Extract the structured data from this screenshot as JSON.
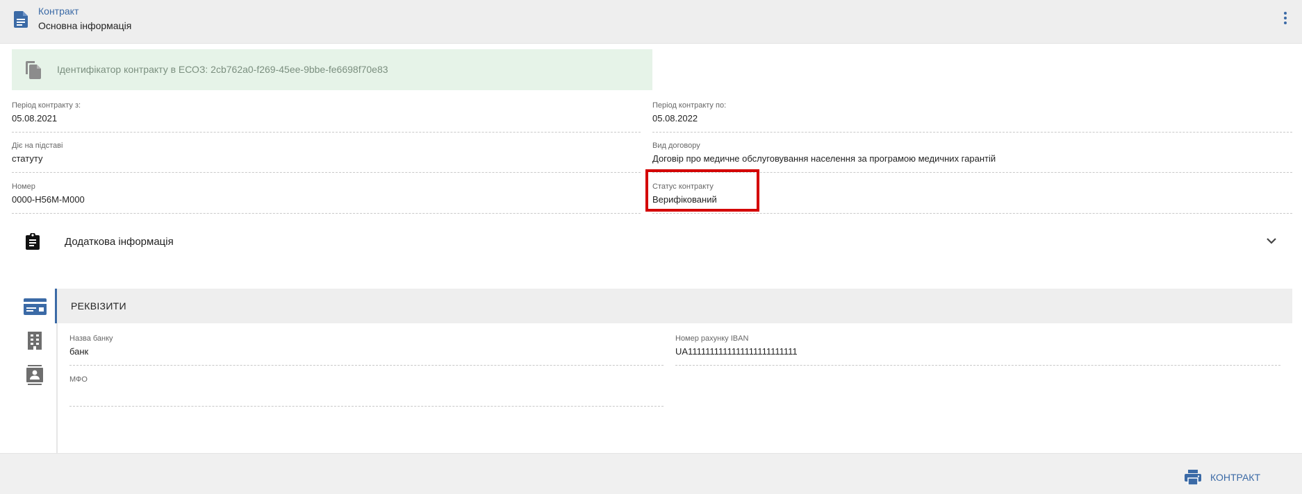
{
  "header": {
    "breadcrumb": "Контракт",
    "subtitle": "Основна інформація",
    "menu_icon": "more-vert-icon"
  },
  "id_banner": {
    "text": "Ідентифікатор контракту в ЕСОЗ: 2cb762a0-f269-45ee-9bbe-fe6698f70e83",
    "icon": "copy-icon"
  },
  "fields": {
    "period_from": {
      "label": "Період контракту з:",
      "value": "05.08.2021"
    },
    "period_to": {
      "label": "Період контракту по:",
      "value": "05.08.2022"
    },
    "basis": {
      "label": "Діє на підставі",
      "value": "статуту"
    },
    "contract_type": {
      "label": "Вид договору",
      "value": "Договір про медичне обслуговування населення за програмою медичних гарантій"
    },
    "number": {
      "label": "Номер",
      "value": "0000-H56M-M000"
    },
    "status": {
      "label": "Статус контракту",
      "value": "Верифікований"
    }
  },
  "additional": {
    "title": "Додаткова інформація",
    "icon": "clipboard-icon",
    "toggle_icon": "chevron-down-icon"
  },
  "requisites": {
    "title": "РЕКВІЗИТИ",
    "bank_name": {
      "label": "Назва банку",
      "value": "банк"
    },
    "iban": {
      "label": "Номер рахунку IBAN",
      "value": "UA1111111111111111111111111"
    },
    "mfo": {
      "label": "МФО",
      "value": ""
    }
  },
  "side_icons": [
    "credit-card-icon",
    "building-icon",
    "contact-card-icon"
  ],
  "footer": {
    "print_label": "КОНТРАКТ",
    "print_icon": "printer-icon"
  },
  "colors": {
    "accent": "#3b6aa6",
    "banner_bg": "#e6f3e8",
    "highlight": "#d40000",
    "header_bg": "#eeeeee"
  }
}
